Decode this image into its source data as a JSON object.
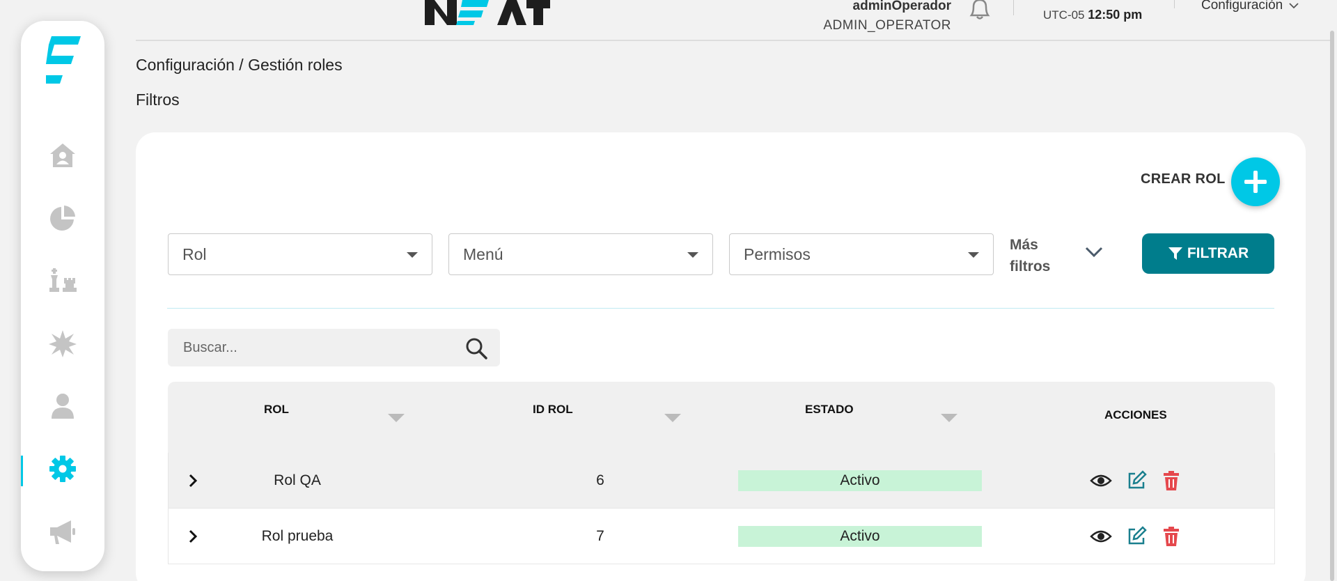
{
  "header": {
    "user_name": "adminOperador",
    "user_role": "ADMIN_OPERATOR",
    "timezone": "UTC-05",
    "time": "12:50 pm",
    "config_menu": "Configuración"
  },
  "sidebar": {
    "items": [
      {
        "icon": "home-icon"
      },
      {
        "icon": "pie-chart-icon"
      },
      {
        "icon": "chess-icon"
      },
      {
        "icon": "burst-icon"
      },
      {
        "icon": "user-icon"
      },
      {
        "icon": "gear-icon",
        "active": true
      },
      {
        "icon": "megaphone-icon"
      }
    ]
  },
  "page": {
    "breadcrumb": "Configuración / Gestión roles",
    "filters_title": "Filtros"
  },
  "actions": {
    "create_label": "CREAR ROL",
    "filter_label": "FILTRAR",
    "more_filters_line1": "Más",
    "more_filters_line2": "filtros"
  },
  "filters": {
    "rol": "Rol",
    "menu": "Menú",
    "permisos": "Permisos"
  },
  "search": {
    "placeholder": "Buscar..."
  },
  "table": {
    "columns": [
      "ROL",
      "ID ROL",
      "ESTADO",
      "ACCIONES"
    ],
    "rows": [
      {
        "rol": "Rol QA",
        "id": "6",
        "estado": "Activo"
      },
      {
        "rol": "Rol prueba",
        "id": "7",
        "estado": "Activo"
      }
    ]
  },
  "colors": {
    "accent": "#00c8e6",
    "primary_button": "#007d8c",
    "active_badge": "#c8f3d7",
    "delete": "#e5484d",
    "edit": "#1a7f8e"
  }
}
